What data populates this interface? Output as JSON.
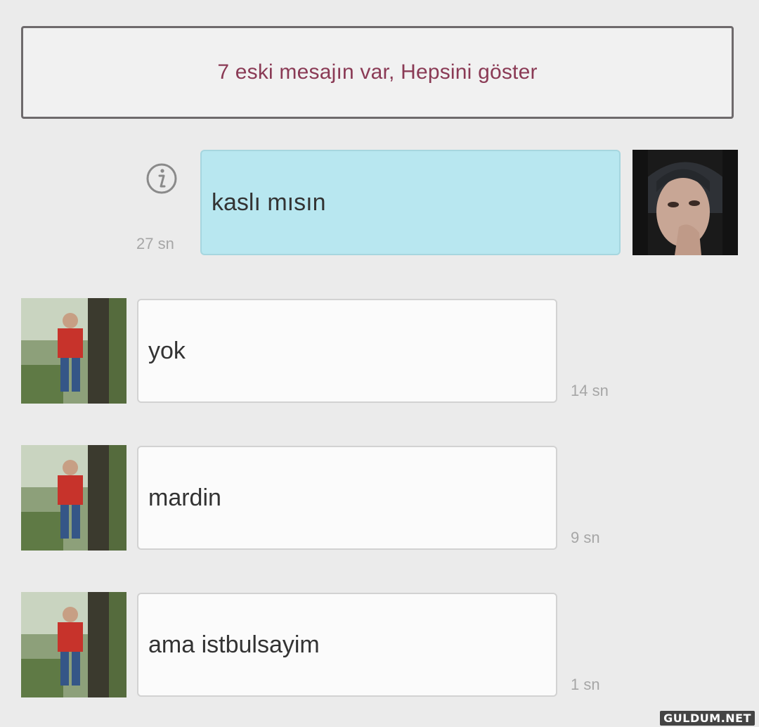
{
  "old_messages_banner": {
    "label": "7 eski mesajın var, Hepsini göster"
  },
  "messages": [
    {
      "direction": "sent",
      "text": "kaslı mısın",
      "time": "27 sn"
    },
    {
      "direction": "received",
      "text": "yok",
      "time": "14 sn"
    },
    {
      "direction": "received",
      "text": "mardin",
      "time": "9 sn"
    },
    {
      "direction": "received",
      "text": "ama istbulsayim",
      "time": "1 sn"
    }
  ],
  "icons": {
    "info": "info-icon"
  },
  "watermark": "GULDUM.NET",
  "colors": {
    "background": "#ebebeb",
    "sent_bubble": "#b8e7f0",
    "received_bubble": "#fbfbfb",
    "banner_text": "#8a3a55",
    "timestamp": "#a6a6a6"
  }
}
